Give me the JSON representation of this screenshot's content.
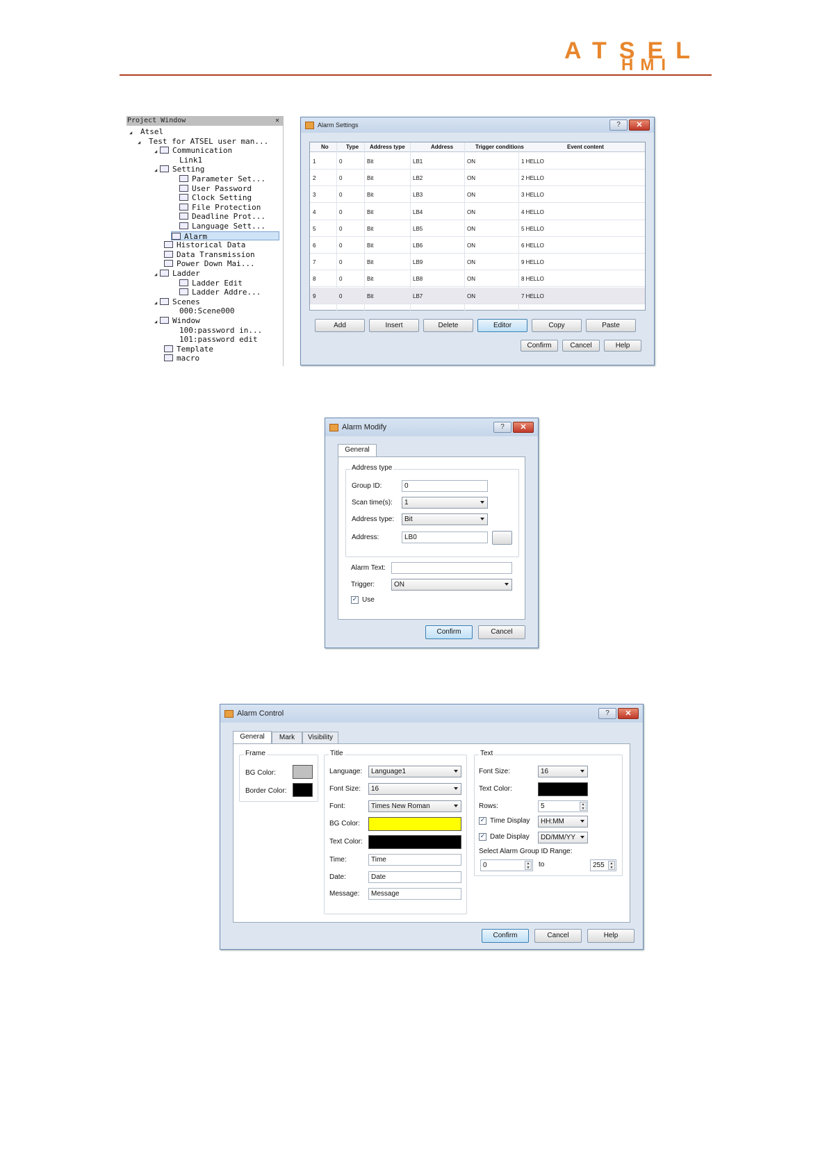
{
  "header": {
    "logo_line1": "ATSEL",
    "logo_line2": "HMI"
  },
  "project_window": {
    "title": "Project Window",
    "items": [
      {
        "label": "Atsel",
        "level": 0,
        "toggle": "◢",
        "icon": ""
      },
      {
        "label": "Test for ATSEL user man...",
        "level": 1,
        "toggle": "◢",
        "icon": ""
      },
      {
        "label": "Communication",
        "level": 2,
        "toggle": "◢",
        "icon": "network-icon"
      },
      {
        "label": "Link1",
        "level": 3,
        "toggle": "",
        "icon": ""
      },
      {
        "label": "Setting",
        "level": 2,
        "toggle": "◢",
        "icon": "gear-icon"
      },
      {
        "label": "Parameter Set...",
        "level": 3,
        "toggle": "",
        "icon": "parameter-icon"
      },
      {
        "label": "User Password",
        "level": 3,
        "toggle": "",
        "icon": "password-icon"
      },
      {
        "label": "Clock Setting",
        "level": 3,
        "toggle": "",
        "icon": "clock-icon"
      },
      {
        "label": "File Protection",
        "level": 3,
        "toggle": "",
        "icon": "file-protection-icon"
      },
      {
        "label": "Deadline Prot...",
        "level": 3,
        "toggle": "",
        "icon": "deadline-icon"
      },
      {
        "label": "Language Sett...",
        "level": 3,
        "toggle": "",
        "icon": "language-icon"
      },
      {
        "label": "Alarm",
        "level": 2,
        "toggle": "",
        "icon": "alarm-icon",
        "selected": true
      },
      {
        "label": "Historical Data",
        "level": 2,
        "toggle": "",
        "icon": "historical-data-icon"
      },
      {
        "label": "Data Transmission",
        "level": 2,
        "toggle": "",
        "icon": "data-transmission-icon"
      },
      {
        "label": "Power Down Mai...",
        "level": 2,
        "toggle": "",
        "icon": "power-down-icon"
      },
      {
        "label": "Ladder",
        "level": 2,
        "toggle": "◢",
        "icon": "ladder-icon"
      },
      {
        "label": "Ladder Edit",
        "level": 3,
        "toggle": "",
        "icon": "ladder-edit-icon"
      },
      {
        "label": "Ladder Addre...",
        "level": 3,
        "toggle": "",
        "icon": "ladder-address-icon"
      },
      {
        "label": "Scenes",
        "level": 2,
        "toggle": "◢",
        "icon": "scenes-icon"
      },
      {
        "label": "000:Scene000",
        "level": 3,
        "toggle": "",
        "icon": ""
      },
      {
        "label": "Window",
        "level": 2,
        "toggle": "◢",
        "icon": "window-icon"
      },
      {
        "label": "100:password in...",
        "level": 3,
        "toggle": "",
        "icon": ""
      },
      {
        "label": "101:password  edit",
        "level": 3,
        "toggle": "",
        "icon": ""
      },
      {
        "label": "Template",
        "level": 2,
        "toggle": "",
        "icon": "template-icon"
      },
      {
        "label": "macro",
        "level": 2,
        "toggle": "",
        "icon": "macro-icon"
      }
    ]
  },
  "alarm_settings": {
    "title": "Alarm Settings",
    "help_glyph": "?",
    "close_glyph": "✕",
    "columns": [
      "No",
      "Type",
      "Address type",
      "Address",
      "Trigger conditions",
      "Event content"
    ],
    "rows": [
      [
        "1",
        "0",
        "Bit",
        "LB1",
        "ON",
        "1 HELLO"
      ],
      [
        "2",
        "0",
        "Bit",
        "LB2",
        "ON",
        "2 HELLO"
      ],
      [
        "3",
        "0",
        "Bit",
        "LB3",
        "ON",
        "3 HELLO"
      ],
      [
        "4",
        "0",
        "Bit",
        "LB4",
        "ON",
        "4 HELLO"
      ],
      [
        "5",
        "0",
        "Bit",
        "LB5",
        "ON",
        "5 HELLO"
      ],
      [
        "6",
        "0",
        "Bit",
        "LB6",
        "ON",
        "6 HELLO"
      ],
      [
        "7",
        "0",
        "Bit",
        "LB9",
        "ON",
        "9 HELLO"
      ],
      [
        "8",
        "0",
        "Bit",
        "LB8",
        "ON",
        "8 HELLO"
      ],
      [
        "9",
        "0",
        "Bit",
        "LB7",
        "ON",
        "7 HELLO"
      ]
    ],
    "buttons": {
      "add": "Add",
      "insert": "Insert",
      "delete": "Delete",
      "editor": "Editor",
      "copy": "Copy",
      "paste": "Paste",
      "confirm": "Confirm",
      "cancel": "Cancel",
      "help": "Help"
    }
  },
  "alarm_modify": {
    "title": "Alarm Modify",
    "tab_general": "General",
    "group_address": "Address type",
    "group_id_label": "Group ID:",
    "group_id_value": "0",
    "scan_time_label": "Scan time(s):",
    "scan_time_value": "1",
    "address_type_label": "Address type:",
    "address_type_value": "Bit",
    "address_label": "Address:",
    "address_value": "LB0",
    "alarm_text_label": "Alarm Text:",
    "alarm_text_value": "",
    "trigger_label": "Trigger:",
    "trigger_value": "ON",
    "use_label": "Use",
    "use_checked": "✓",
    "confirm": "Confirm",
    "cancel": "Cancel"
  },
  "alarm_control": {
    "title": "Alarm Control",
    "tabs": [
      "General",
      "Mark",
      "Visibility"
    ],
    "frame": {
      "label": "Frame",
      "bg_color_label": "BG Color:",
      "border_color_label": "Border Color:",
      "bg_color": "#c0c0c0",
      "border_color": "#000000"
    },
    "title_group": {
      "label": "Title",
      "language_label": "Language:",
      "language_value": "Language1",
      "font_size_label": "Font Size:",
      "font_size_value": "16",
      "font_label": "Font:",
      "font_value": "Times New Roman",
      "bg_color_label": "BG Color:",
      "bg_color": "#ffff00",
      "text_color_label": "Text Color:",
      "text_color": "#000000",
      "time_label": "Time:",
      "time_value": "Time",
      "date_label": "Date:",
      "date_value": "Date",
      "message_label": "Message:",
      "message_value": "Message"
    },
    "text_group": {
      "label": "Text",
      "font_size_label": "Font Size:",
      "font_size_value": "16",
      "text_color_label": "Text Color:",
      "text_color": "#000000",
      "rows_label": "Rows:",
      "rows_value": "5",
      "time_display_label": "Time Display",
      "time_display_value": "HH:MM",
      "date_display_label": "Date Display",
      "date_display_value": "DD/MM/YY",
      "range_label": "Select Alarm Group ID Range:",
      "range_from": "0",
      "range_to_label": "to",
      "range_to": "255",
      "checked": "✓"
    },
    "confirm": "Confirm",
    "cancel": "Cancel",
    "help": "Help"
  }
}
